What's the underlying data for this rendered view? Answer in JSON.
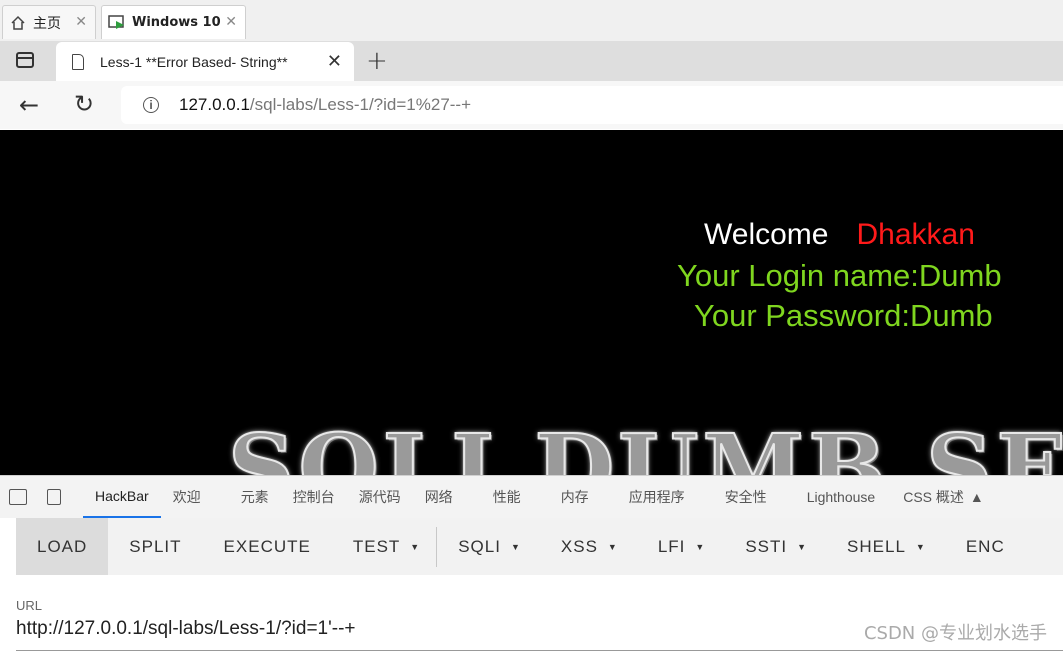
{
  "vm_tabs": [
    {
      "label": "主页",
      "icon": "home-icon"
    },
    {
      "label": "Windows 10",
      "icon": "vm-icon"
    }
  ],
  "browser": {
    "tab_title": "Less-1 **Error Based- String**",
    "url_host": "127.0.0.1",
    "url_path": "/sql-labs/Less-1/?id=1%27--+"
  },
  "page": {
    "welcome": "Welcome",
    "name": "Dhakkan",
    "login_line": "Your Login name:Dumb",
    "password_line": "Your Password:Dumb",
    "banner": "SQLI DUMB SE"
  },
  "devtools_tabs": [
    "HackBar",
    "欢迎",
    "元素",
    "控制台",
    "源代码",
    "网络",
    "性能",
    "内存",
    "应用程序",
    "安全性",
    "Lighthouse",
    "CSS 概述"
  ],
  "hackbar": {
    "buttons": [
      {
        "label": "LOAD",
        "dropdown": false
      },
      {
        "label": "SPLIT",
        "dropdown": false
      },
      {
        "label": "EXECUTE",
        "dropdown": false
      },
      {
        "label": "TEST",
        "dropdown": true
      },
      {
        "label": "SQLI",
        "dropdown": true
      },
      {
        "label": "XSS",
        "dropdown": true
      },
      {
        "label": "LFI",
        "dropdown": true
      },
      {
        "label": "SSTI",
        "dropdown": true
      },
      {
        "label": "SHELL",
        "dropdown": true
      },
      {
        "label": "ENC",
        "dropdown": false
      }
    ],
    "url_label": "URL",
    "url_value": "http://127.0.0.1/sql-labs/Less-1/?id=1'--+"
  },
  "watermark": "CSDN @专业划水选手",
  "colors": {
    "welcome_name": "#ff1a1a",
    "login_text": "#7fd61f",
    "active_tab": "#1a73e8"
  }
}
